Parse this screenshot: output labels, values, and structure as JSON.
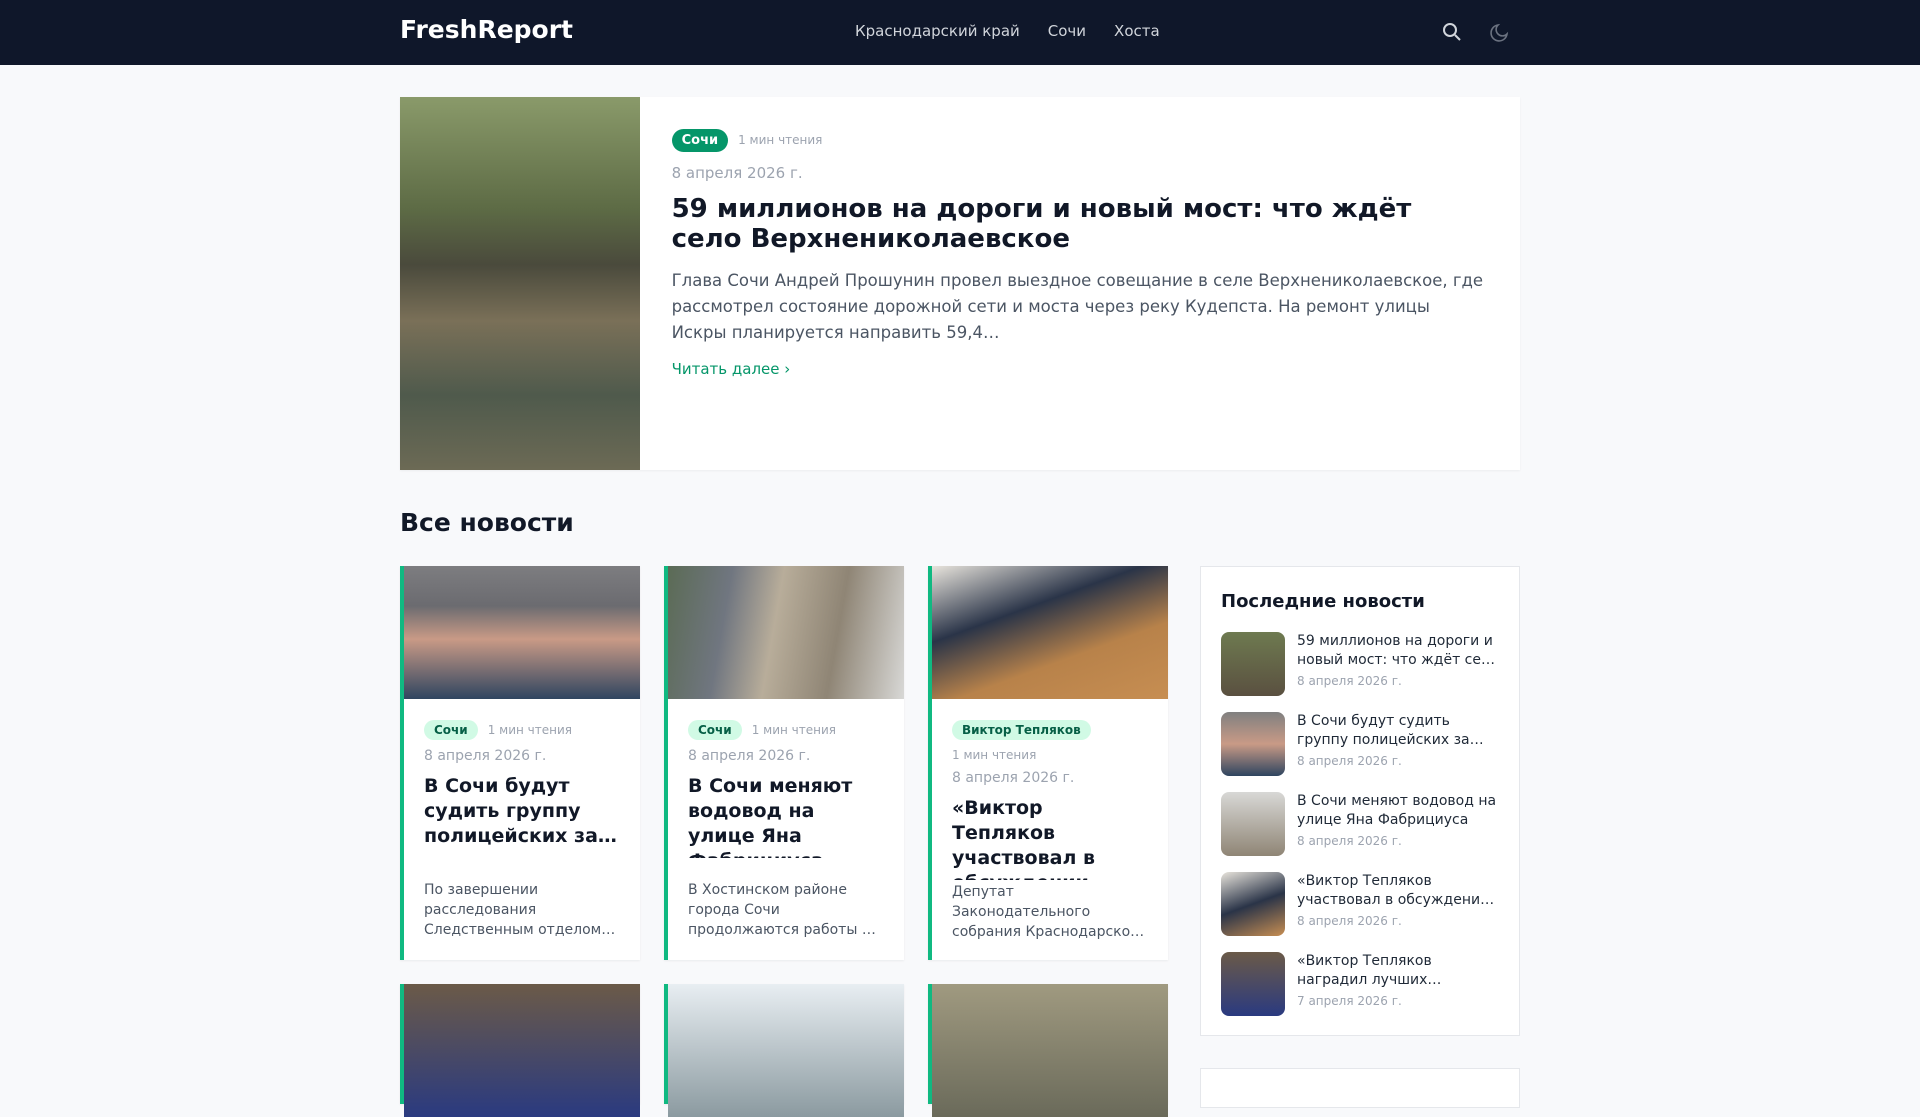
{
  "header": {
    "logo": "FreshReport",
    "nav": [
      "Краснодарский край",
      "Сочи",
      "Хоста"
    ]
  },
  "hero": {
    "tag": "Сочи",
    "read": "1 мин чтения",
    "date": "8 апреля 2026 г.",
    "title": "59 миллионов на дороги и новый мост: что ждёт село Верхнениколаевское",
    "desc": "Глава Сочи Андрей Прошунин провел выездное совещание в селе Верхнениколаевское, где рассмотрел состояние дорожной сети и моста через реку Кудепста. На ремонт улицы Искры планируется направить 59,4…",
    "more": "Читать далее"
  },
  "section_title": "Все новости",
  "cards": [
    {
      "tag": "Сочи",
      "read": "1 мин чтения",
      "date": "8 апреля 2026 г.",
      "title": "В Сочи будут судить группу полицейских за…",
      "desc": "По завершении расследования Следственным отделом…"
    },
    {
      "tag": "Сочи",
      "read": "1 мин чтения",
      "date": "8 апреля 2026 г.",
      "title": "В Сочи меняют водовод на улице Яна Фабрициуса",
      "desc": "В Хостинском районе города Сочи продолжаются работы …"
    },
    {
      "tag": "Виктор Тепляков",
      "read": "1 мин чтения",
      "date": "8 апреля 2026 г.",
      "title": "«Виктор Тепляков участвовал в обсуждении…",
      "desc": "Депутат Законодательного собрания Краснодарско…"
    }
  ],
  "sidebar": {
    "title": "Последние новости",
    "items": [
      {
        "title": "59 миллионов на дороги и новый мост: что ждёт се…",
        "date": "8 апреля 2026 г."
      },
      {
        "title": "В Сочи будут судить группу полицейских за…",
        "date": "8 апреля 2026 г."
      },
      {
        "title": "В Сочи меняют водовод на улице Яна Фабрициуса",
        "date": "8 апреля 2026 г."
      },
      {
        "title": "«Виктор Тепляков участвовал в обсуждени…",
        "date": "8 апреля 2026 г."
      },
      {
        "title": "«Виктор Тепляков наградил лучших…",
        "date": "7 апреля 2026 г."
      }
    ]
  }
}
